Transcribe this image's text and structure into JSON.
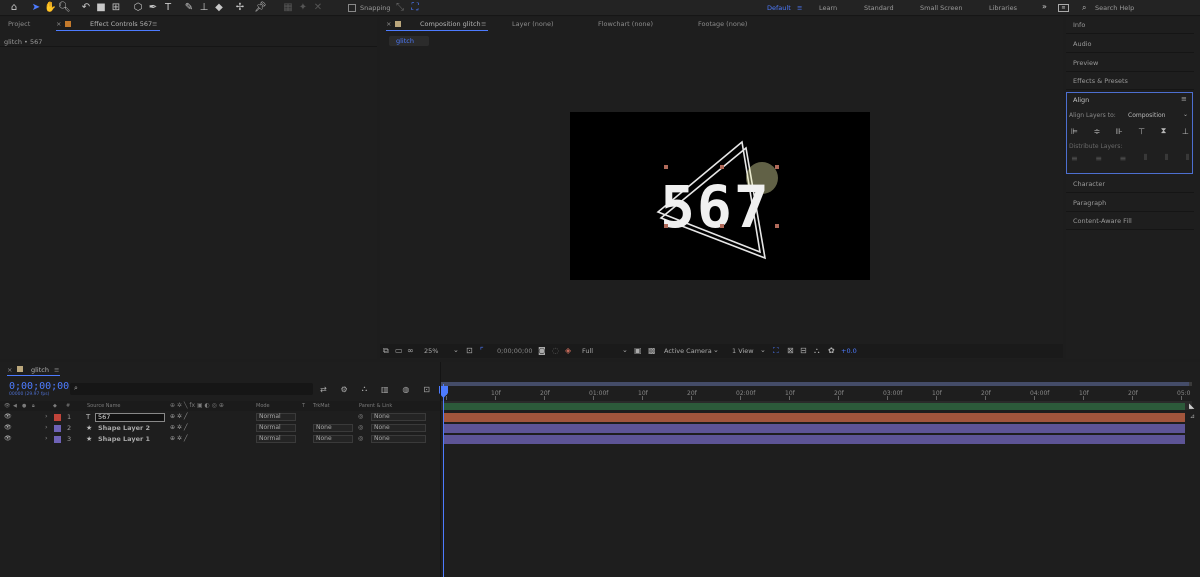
{
  "toolbar": {
    "snapping_label": "Snapping",
    "workspaces": [
      "Default",
      "Learn",
      "Standard",
      "Small Screen",
      "Libraries"
    ],
    "search_placeholder": "Search Help"
  },
  "left_panel": {
    "tab_project": "Project",
    "tab_effect_controls": "Effect Controls 567",
    "subtitle": "glitch • 567"
  },
  "viewer": {
    "tab_composition": "Composition glitch",
    "tab_layer": "Layer (none)",
    "tab_flowchart": "Flowchart (none)",
    "tab_footage": "Footage (none)",
    "comp_breadcrumb": "glitch",
    "comp_text": "567",
    "zoom": "25%",
    "timecode": "0;00;00;00",
    "resolution": "Full",
    "camera": "Active Camera",
    "view": "1 View",
    "exposure": "+0.0"
  },
  "right_panel": {
    "info": "Info",
    "audio": "Audio",
    "preview": "Preview",
    "effects_presets": "Effects & Presets",
    "align": "Align",
    "align_layers_to_label": "Align Layers to:",
    "align_layers_to_value": "Composition",
    "distribute_layers": "Distribute Layers:",
    "character": "Character",
    "paragraph": "Paragraph",
    "content_aware_fill": "Content-Aware Fill"
  },
  "timeline": {
    "tab": "glitch",
    "timecode": "0;00;00;00",
    "timecode_sub": "00000 (29.97 fps)",
    "headers": {
      "source_name": "Source Name",
      "mode": "Mode",
      "t": "T",
      "trkmat": "TrkMat",
      "parent": "Parent & Link"
    },
    "layers": [
      {
        "num": "1",
        "type": "T",
        "name": "567",
        "mode": "Normal",
        "trkmat": "",
        "parent": "None",
        "color": "#c0443a"
      },
      {
        "num": "2",
        "type": "★",
        "name": "Shape Layer 2",
        "mode": "Normal",
        "trkmat": "None",
        "parent": "None",
        "color": "#6e62b6"
      },
      {
        "num": "3",
        "type": "★",
        "name": "Shape Layer 1",
        "mode": "Normal",
        "trkmat": "None",
        "parent": "None",
        "color": "#6e62b6"
      }
    ],
    "ruler": [
      "0f",
      "10f",
      "20f",
      "01:00f",
      "10f",
      "20f",
      "02:00f",
      "10f",
      "20f",
      "03:00f",
      "10f",
      "20f",
      "04:00f",
      "10f",
      "20f",
      "05:0"
    ]
  }
}
